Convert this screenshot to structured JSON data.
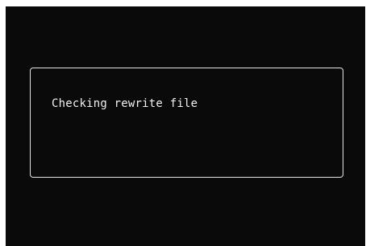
{
  "screen": {
    "dialog": {
      "message": "Checking rewrite file"
    }
  },
  "colors": {
    "background": "#0a0a0a",
    "border": "#e6e6e6",
    "text": "#f2f2f2"
  }
}
